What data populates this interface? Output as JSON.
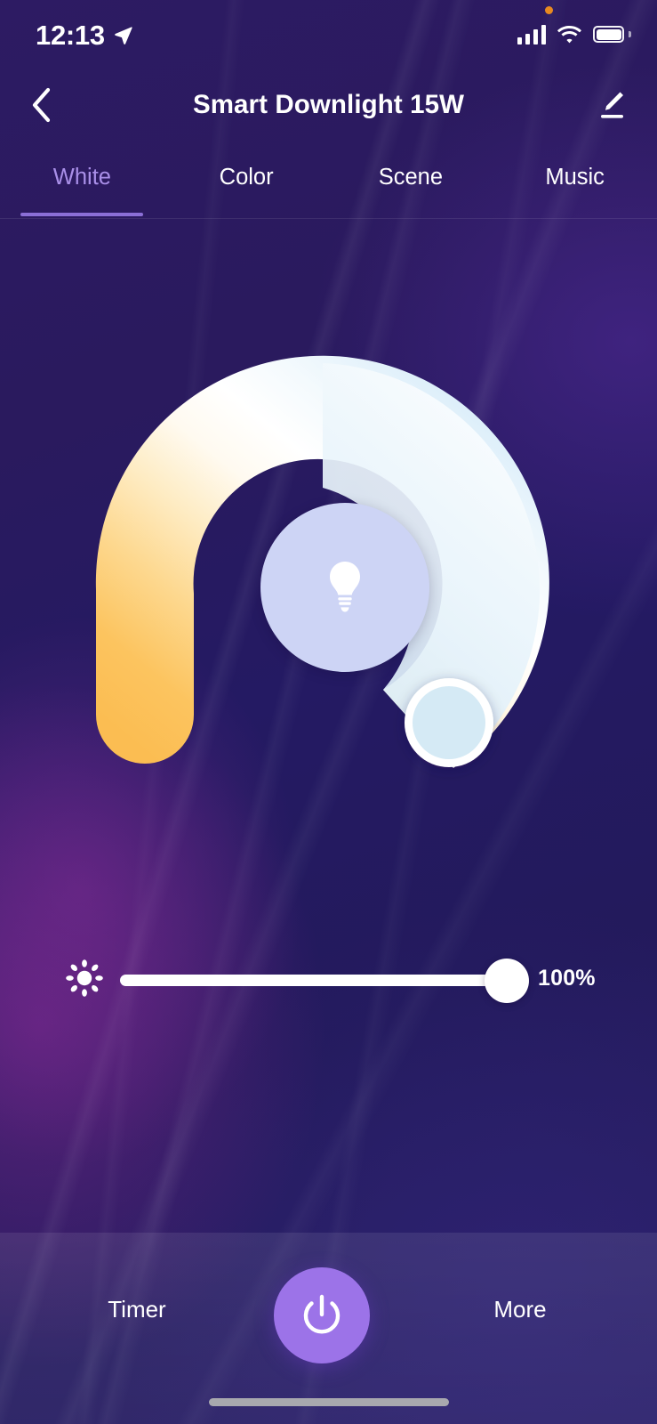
{
  "status_bar": {
    "time": "12:13",
    "location_icon": "location-arrow-icon",
    "signal_icon": "cellular-signal-icon",
    "wifi_icon": "wifi-icon",
    "battery_icon": "battery-full-icon",
    "recording_dot_color": "#e88a20"
  },
  "header": {
    "back_icon": "chevron-left-icon",
    "title": "Smart Downlight 15W",
    "edit_icon": "pencil-edit-icon"
  },
  "tabs": {
    "items": [
      {
        "label": "White",
        "active": true
      },
      {
        "label": "Color",
        "active": false
      },
      {
        "label": "Scene",
        "active": false
      },
      {
        "label": "Music",
        "active": false
      }
    ],
    "active_color": "#a98fe8",
    "indicator_color": "#8b6fd6",
    "inactive_color": "#ffffff"
  },
  "color_temperature_dial": {
    "control_name": "color-temperature-dial",
    "center_icon": "light-bulb-icon",
    "center_circle_color": "#cdd4f5",
    "warm_end_color": "#fbc05b",
    "mid_color": "#ffffff",
    "cool_end_color": "#dceefa",
    "handle_fill_color": "#d5eaf5",
    "handle_ring_color": "#ffffff"
  },
  "brightness": {
    "icon": "brightness-sun-icon",
    "value_label": "100%",
    "value": 100,
    "min": 0,
    "max": 100,
    "track_color": "#ffffff",
    "thumb_color": "#ffffff"
  },
  "bottom_bar": {
    "timer_label": "Timer",
    "power_icon": "power-icon",
    "power_button_color": "#9c73e8",
    "more_label": "More"
  }
}
